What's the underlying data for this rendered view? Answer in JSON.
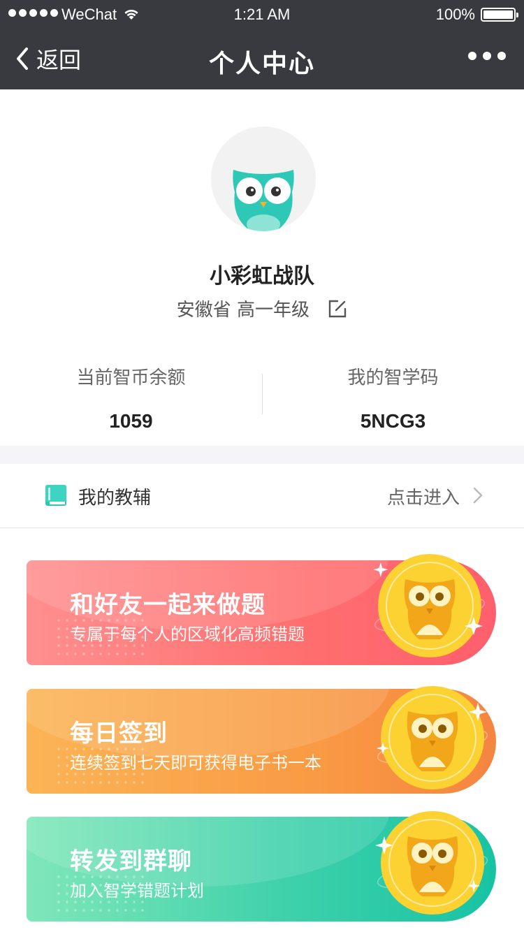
{
  "status_bar": {
    "carrier": "WeChat",
    "time": "1:21 AM",
    "battery": "100%"
  },
  "nav": {
    "back_label": "返回",
    "title": "个人中心"
  },
  "profile": {
    "name": "小彩虹战队",
    "location_grade": "安徽省 高一年级"
  },
  "stats": [
    {
      "label": "当前智币余额",
      "value": "1059"
    },
    {
      "label": "我的智学码",
      "value": "5NCG3"
    }
  ],
  "fudao": {
    "label": "我的教辅",
    "action": "点击进入"
  },
  "cards": [
    {
      "title": "和好友一起来做题",
      "subtitle": "专属于每个人的区域化高频错题"
    },
    {
      "title": "每日签到",
      "subtitle": "连续签到七天即可获得电子书一本"
    },
    {
      "title": "转发到群聊",
      "subtitle": "加入智学错题计划"
    }
  ],
  "colors": {
    "nav_bg": "#393a3f",
    "brand_teal": "#2ec9b6",
    "card_red": "#ff6e6e",
    "card_orange": "#f99b44",
    "card_green": "#3fd1aa",
    "coin_gold": "#fbd232"
  }
}
